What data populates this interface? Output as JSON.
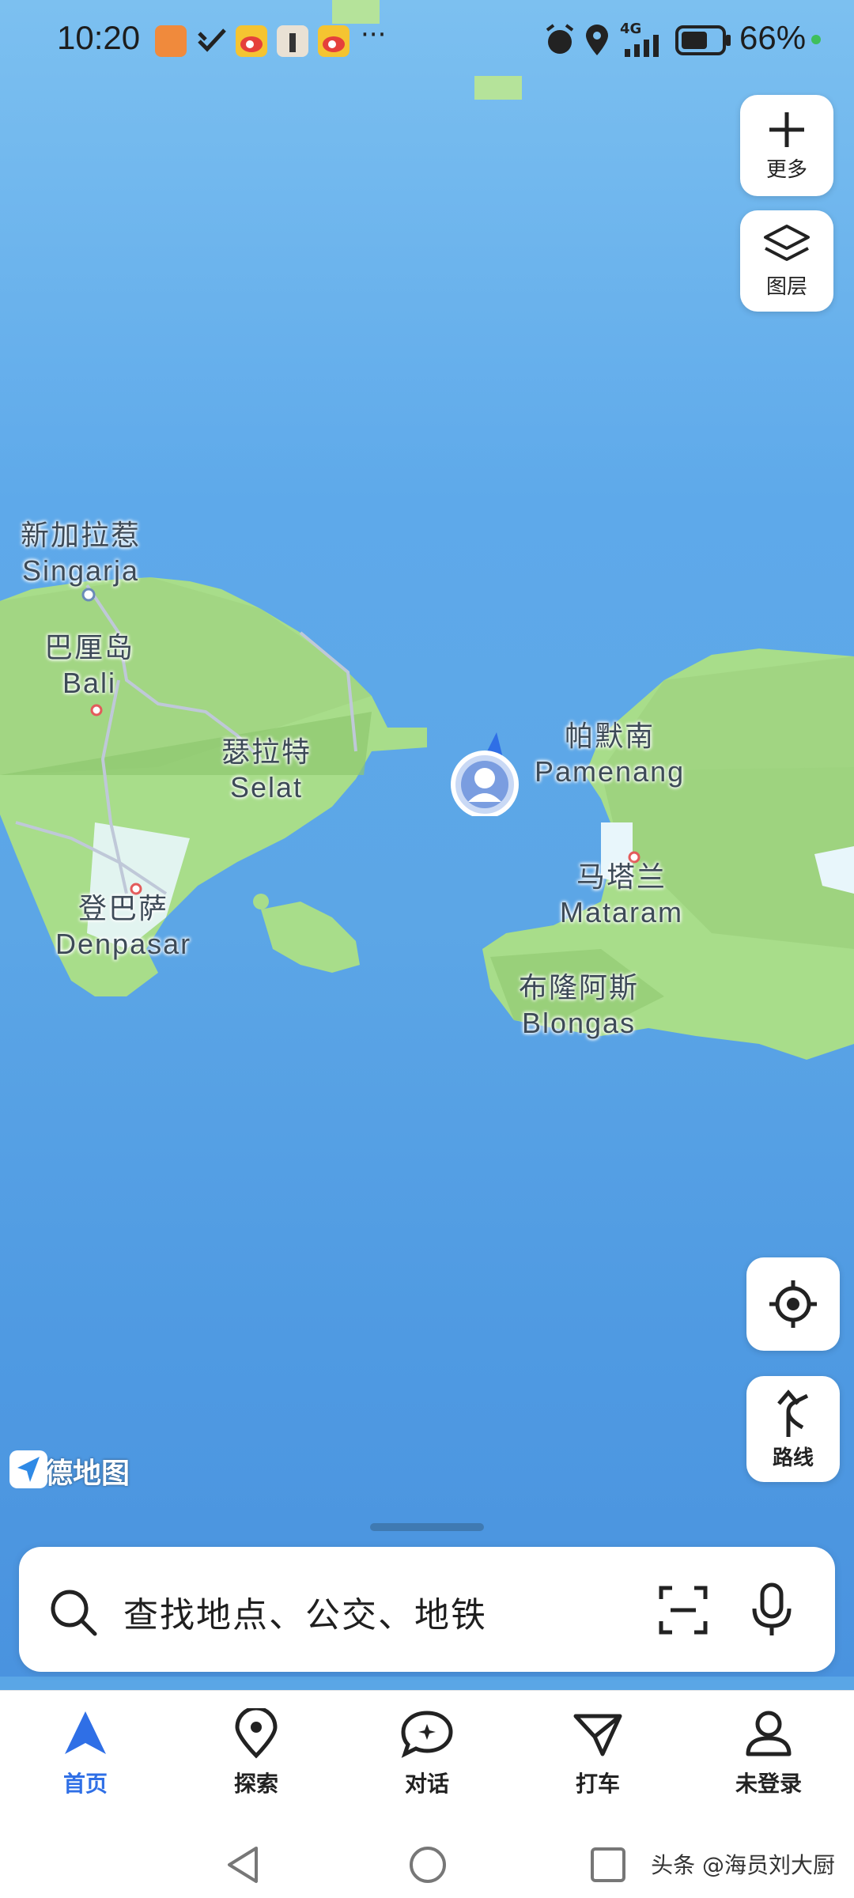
{
  "status_bar": {
    "time": "10:20",
    "overflow": "···",
    "network": "4G",
    "battery": "66%"
  },
  "map": {
    "labels": [
      {
        "zh": "新加拉惹",
        "en": "Singarja"
      },
      {
        "zh": "巴厘岛",
        "en": "Bali"
      },
      {
        "zh": "瑟拉特",
        "en": "Selat"
      },
      {
        "zh": "登巴萨",
        "en": "Denpasar"
      },
      {
        "zh": "帕默南",
        "en": "Pamenang"
      },
      {
        "zh": "马塔兰",
        "en": "Mataram"
      },
      {
        "zh": "布隆阿斯",
        "en": "Blongas"
      }
    ],
    "logo": "高德地图",
    "colors": {
      "water": "#5ea9ea",
      "land": "#a8dd8a",
      "accent": "#2f6fe6"
    }
  },
  "controls": {
    "more_label": "更多",
    "layers_label": "图层",
    "route_label": "路线"
  },
  "search": {
    "placeholder": "查找地点、公交、地铁"
  },
  "tabs": [
    {
      "label": "首页",
      "icon": "navigate-arrow-icon"
    },
    {
      "label": "探索",
      "icon": "location-pin-icon"
    },
    {
      "label": "对话",
      "icon": "chat-bubble-icon"
    },
    {
      "label": "打车",
      "icon": "taxi-icon"
    },
    {
      "label": "未登录",
      "icon": "person-icon"
    }
  ],
  "watermark": "头条 @海员刘大厨"
}
